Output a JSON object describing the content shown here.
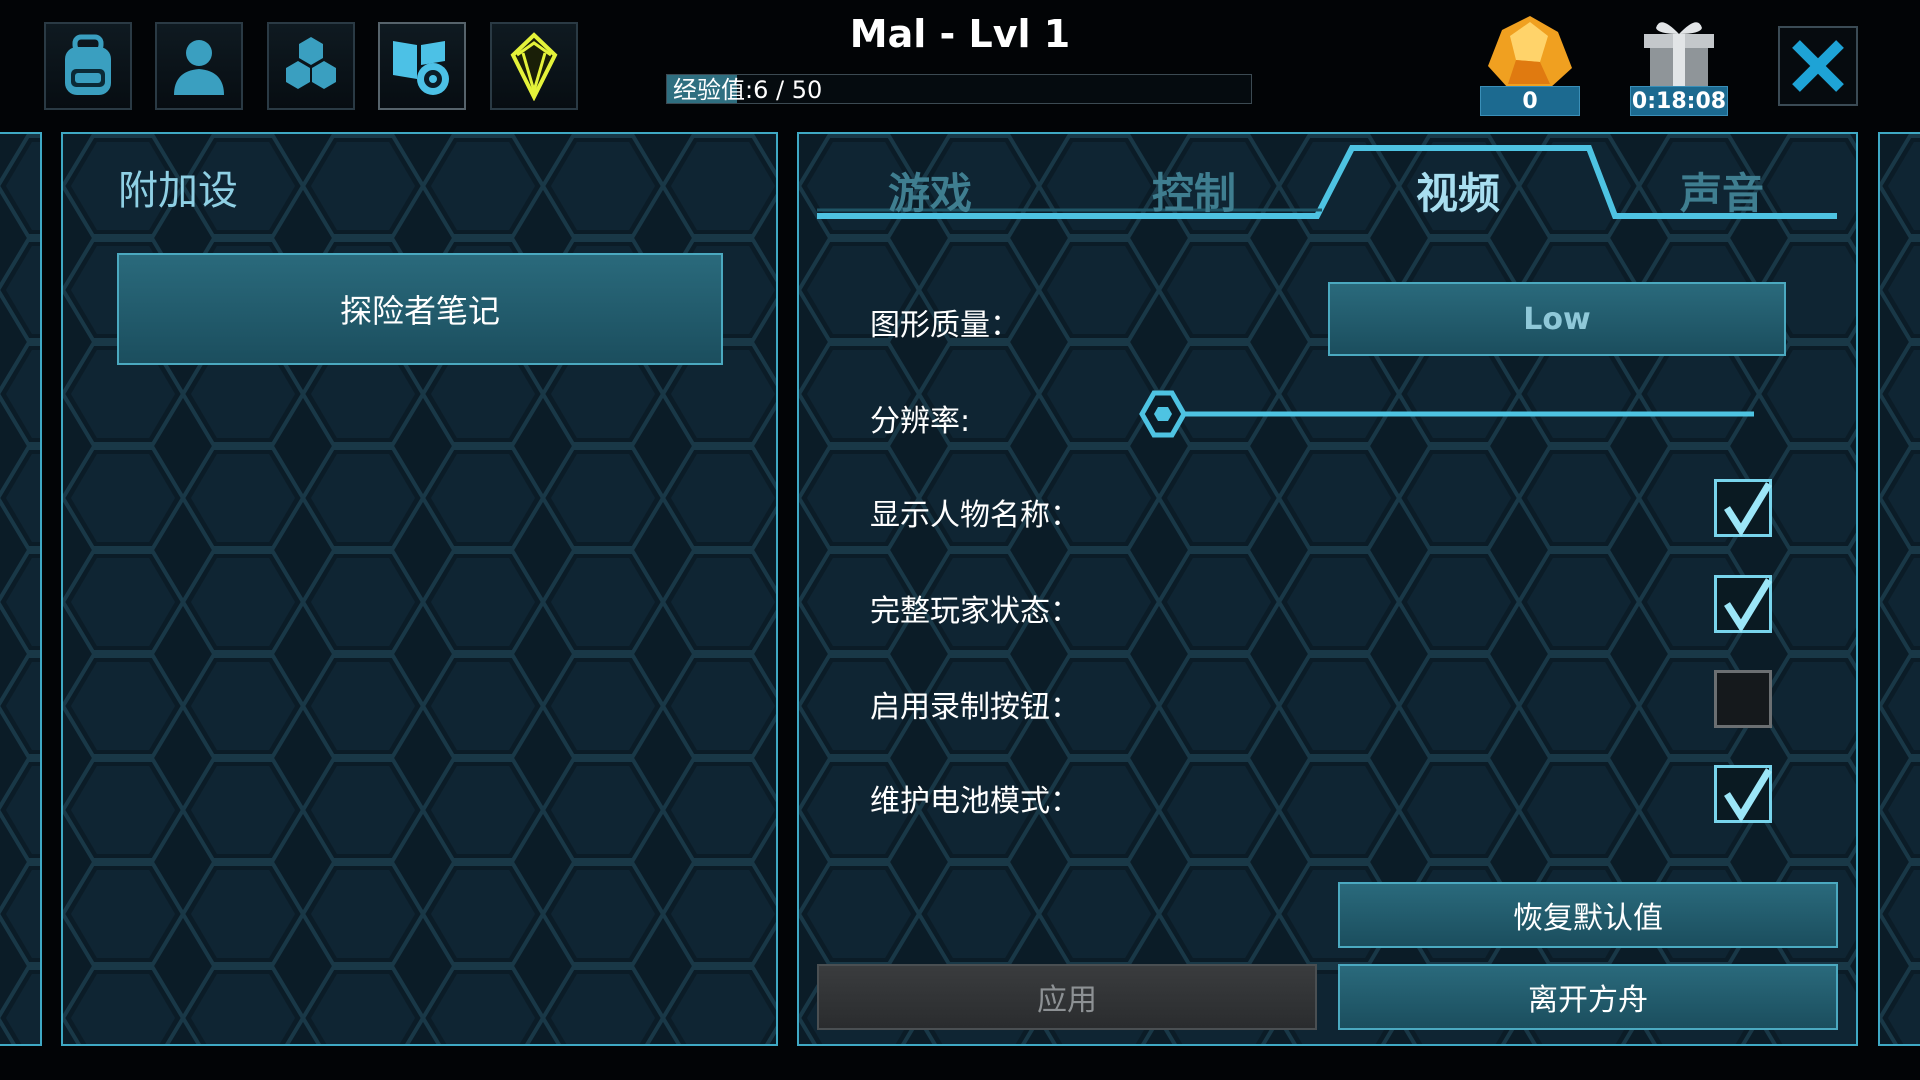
{
  "top": {
    "player_title": "Mal - Lvl 1",
    "xp_text": "经验值:6 / 50",
    "xp_progress": 0.12,
    "gems_count": "0",
    "gift_timer": "0:18:08"
  },
  "icons": {
    "inventory": "backpack-icon",
    "character": "person-icon",
    "engrams": "hexagons-icon",
    "settings": "book-gear-icon",
    "tribe": "crystal-icon",
    "gems": "amber-gem-icon",
    "gift": "gift-box-icon",
    "close": "close-icon"
  },
  "left_panel": {
    "title": "附加设",
    "explorer_notes": "探险者笔记"
  },
  "tabs": [
    {
      "label": "游戏"
    },
    {
      "label": "控制"
    },
    {
      "label": "视频"
    },
    {
      "label": "声音"
    }
  ],
  "settings": {
    "graphics_quality_label": "图形质量：",
    "graphics_quality_value": "Low",
    "resolution_label": "分辨率:",
    "resolution_value": 0.0,
    "show_names_label": "显示人物名称：",
    "show_names": true,
    "full_status_label": "完整玩家状态：",
    "full_status": true,
    "record_button_label": "启用录制按钮：",
    "record_button": false,
    "battery_mode_label": "维护电池模式：",
    "battery_mode": true
  },
  "buttons": {
    "restore_defaults": "恢复默认值",
    "apply": "应用",
    "leave_ark": "离开方舟"
  },
  "colors": {
    "accent": "#3fa9c4",
    "panel_bg": "#0b1c27",
    "check": "#78d4ec"
  }
}
